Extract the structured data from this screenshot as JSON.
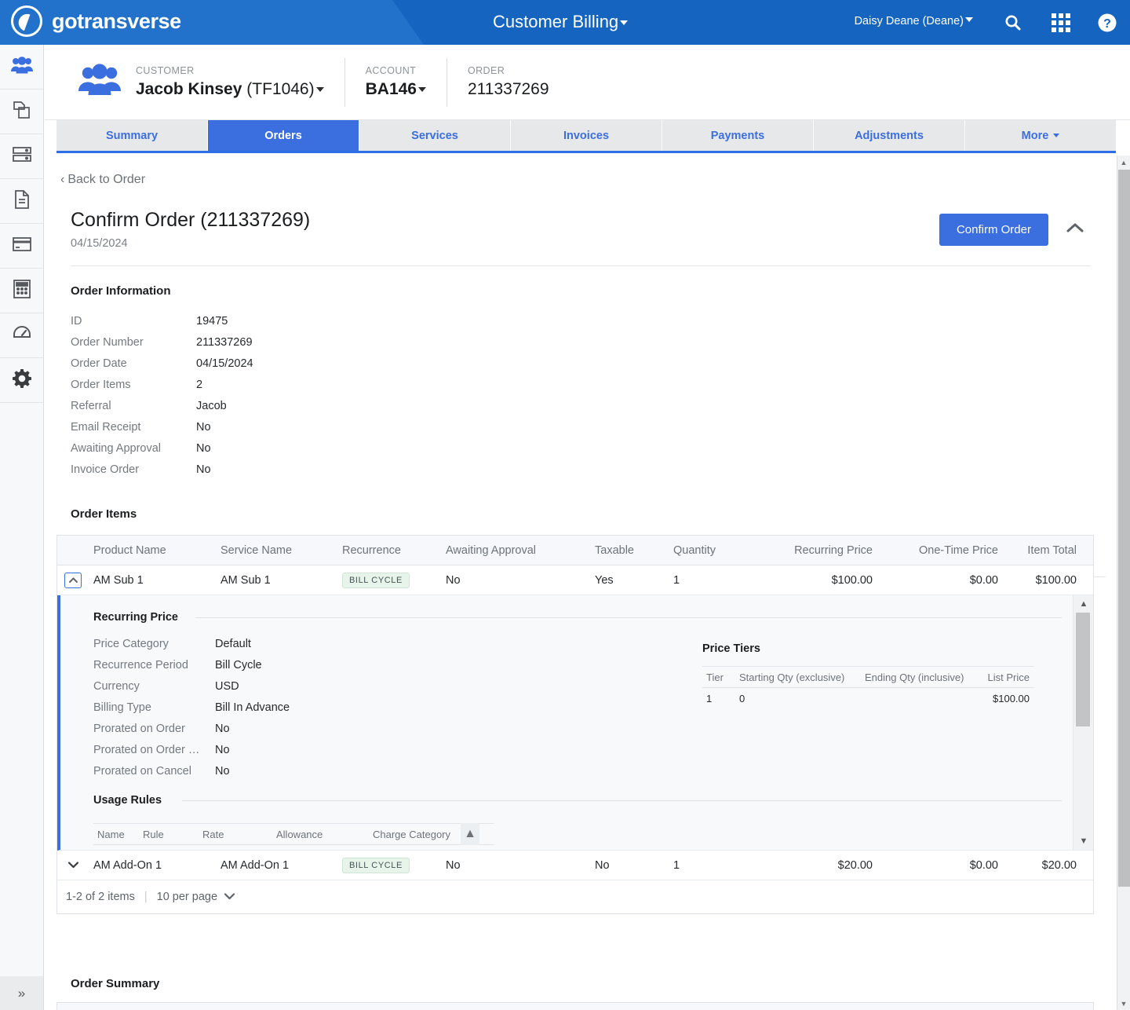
{
  "brand": {
    "name": "gotransverse",
    "logo_icon": "gotransverse-logo-icon",
    "accent": "#1565c0",
    "accent_light": "#2272cc",
    "tab_active": "#3b6fe0"
  },
  "topbar": {
    "app_title": "Customer Billing",
    "user": "Daisy Deane (Deane)",
    "icons": [
      "search-icon",
      "apps-grid-icon",
      "help-icon"
    ]
  },
  "rail": {
    "items": [
      {
        "name": "customers",
        "icon": "people-icon"
      },
      {
        "name": "products",
        "icon": "copy-pages-icon"
      },
      {
        "name": "servers",
        "icon": "server-stack-icon"
      },
      {
        "name": "documents",
        "icon": "document-icon"
      },
      {
        "name": "payments",
        "icon": "credit-card-icon"
      },
      {
        "name": "billing",
        "icon": "calculator-icon"
      },
      {
        "name": "dashboards",
        "icon": "gauge-icon"
      },
      {
        "name": "settings",
        "icon": "gear-icon"
      }
    ],
    "expand_glyph": "»"
  },
  "context": {
    "customer_label": "CUSTOMER",
    "customer_value": "Jacob Kinsey",
    "customer_code": "(TF1046)",
    "account_label": "ACCOUNT",
    "account_value": "BA146",
    "order_label": "ORDER",
    "order_value": "211337269"
  },
  "tabs": [
    {
      "label": "Summary",
      "active": false
    },
    {
      "label": "Orders",
      "active": true
    },
    {
      "label": "Services",
      "active": false
    },
    {
      "label": "Invoices",
      "active": false
    },
    {
      "label": "Payments",
      "active": false
    },
    {
      "label": "Adjustments",
      "active": false
    },
    {
      "label": "More",
      "active": false,
      "has_caret": true
    }
  ],
  "main": {
    "back_link": "Back to Order",
    "card_title": "Confirm Order (211337269)",
    "card_subtitle": "04/15/2024",
    "confirm_button": "Confirm Order",
    "order_information": {
      "heading": "Order Information",
      "rows": [
        {
          "key": "ID",
          "value": "19475"
        },
        {
          "key": "Order Number",
          "value": "211337269"
        },
        {
          "key": "Order Date",
          "value": "04/15/2024"
        },
        {
          "key": "Order Items",
          "value": "2"
        },
        {
          "key": "Referral",
          "value": "Jacob"
        },
        {
          "key": "Email Receipt",
          "value": "No"
        },
        {
          "key": "Awaiting Approval",
          "value": "No"
        },
        {
          "key": "Invoice Order",
          "value": "No"
        }
      ]
    },
    "order_items": {
      "heading": "Order Items",
      "columns": [
        "Product Name",
        "Service Name",
        "Recurrence",
        "Awaiting Approval",
        "Taxable",
        "Quantity",
        "Recurring Price",
        "One-Time Price",
        "Item Total"
      ],
      "rows": [
        {
          "expanded": true,
          "product_name": "AM Sub 1",
          "service_name": "AM Sub 1",
          "recurrence": "BILL CYCLE",
          "awaiting_approval": "No",
          "taxable": "Yes",
          "quantity": "1",
          "recurring_price": "$100.00",
          "one_time_price": "$0.00",
          "item_total": "$100.00"
        },
        {
          "expanded": false,
          "product_name": "AM Add-On 1",
          "service_name": "AM Add-On 1",
          "recurrence": "BILL CYCLE",
          "awaiting_approval": "No",
          "taxable": "No",
          "quantity": "1",
          "recurring_price": "$20.00",
          "one_time_price": "$0.00",
          "item_total": "$20.00"
        }
      ],
      "detail": {
        "recurring_price_heading": "Recurring Price",
        "recurring_price_rows": [
          {
            "key": "Price Category",
            "value": "Default"
          },
          {
            "key": "Recurrence Period",
            "value": "Bill Cycle"
          },
          {
            "key": "Currency",
            "value": "USD"
          },
          {
            "key": "Billing Type",
            "value": "Bill In Advance"
          },
          {
            "key": "Prorated on Order",
            "value": "No"
          },
          {
            "key": "Prorated on Order …",
            "value": "No"
          },
          {
            "key": "Prorated on Cancel",
            "value": "No"
          }
        ],
        "price_tiers_heading": "Price Tiers",
        "price_tiers_columns": [
          "Tier",
          "Starting Qty (exclusive)",
          "Ending Qty (inclusive)",
          "List Price"
        ],
        "price_tiers_rows": [
          {
            "tier": "1",
            "starting_qty": "0",
            "ending_qty": "",
            "list_price": "$100.00"
          }
        ],
        "usage_rules_heading": "Usage Rules",
        "usage_rules_columns": [
          "Name",
          "Rule",
          "Rate",
          "Allowance",
          "Charge Category"
        ],
        "usage_rules_sort_glyph": "▲"
      },
      "pager": {
        "range": "1-2 of 2 items",
        "per_page": "10 per page"
      }
    },
    "order_summary_heading": "Order Summary"
  }
}
